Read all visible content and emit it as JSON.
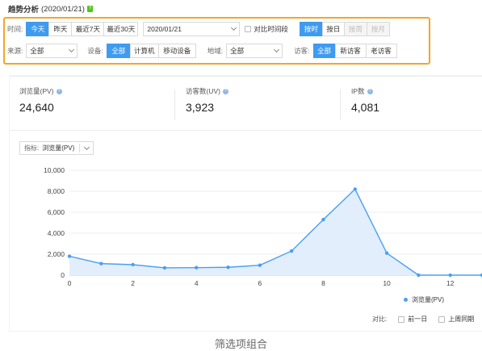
{
  "header": {
    "title": "趋势分析",
    "date": "(2020/01/21)",
    "help": "?"
  },
  "filters": {
    "time_label": "时间:",
    "time_buttons": [
      "今天",
      "昨天",
      "最近7天",
      "最近30天"
    ],
    "date_value": "2020/01/21",
    "compare_label": "对比时间段",
    "granularity": [
      "按时",
      "按日",
      "按周",
      "按月"
    ],
    "source_label": "来源:",
    "source_value": "全部",
    "device_label": "设备:",
    "device_buttons": [
      "全部",
      "计算机",
      "移动设备"
    ],
    "region_label": "地域:",
    "region_value": "全部",
    "visitor_label": "访客:",
    "visitor_buttons": [
      "全部",
      "新访客",
      "老访客"
    ]
  },
  "stats": [
    {
      "label": "浏览量(PV)",
      "value": "24,640"
    },
    {
      "label": "访客数(UV)",
      "value": "3,923"
    },
    {
      "label": "IP数",
      "value": "4,081"
    }
  ],
  "metric": {
    "label": "指标:",
    "value": "浏览量(PV)"
  },
  "chart_data": {
    "type": "area",
    "x": [
      0,
      1,
      2,
      3,
      4,
      5,
      6,
      7,
      8,
      9,
      10,
      11,
      12,
      13
    ],
    "series": [
      {
        "name": "浏览量(PV)",
        "values": [
          1800,
          1100,
          1000,
          700,
          720,
          750,
          950,
          2300,
          5300,
          8200,
          2100,
          0,
          0,
          0
        ]
      }
    ],
    "xticks": [
      0,
      2,
      4,
      6,
      8,
      10,
      12
    ],
    "yticks": [
      "0",
      "2,000",
      "4,000",
      "6,000",
      "8,000",
      "10,000"
    ],
    "xlim": [
      0,
      13
    ],
    "ylim": [
      0,
      10000
    ],
    "color": "#4a9ff0",
    "fill": "#e2eefb"
  },
  "legend": {
    "name": "浏览量(PV)"
  },
  "compare": {
    "label": "对比:",
    "options": [
      "前一日",
      "上周同期"
    ]
  },
  "footer": {
    "caption": "筛选项组合"
  }
}
